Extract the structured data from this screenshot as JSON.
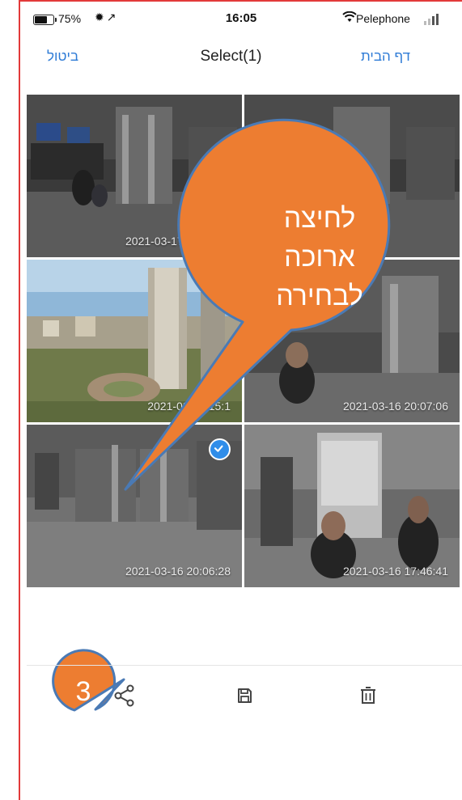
{
  "status_bar": {
    "battery": "75%",
    "battery_level": 0.75,
    "icons": "✹↗",
    "time": "16:05",
    "carrier": "Pelephone"
  },
  "nav": {
    "cancel_label": "ביטול",
    "title": "Select(1)",
    "home_label": "דף הבית"
  },
  "photos": [
    {
      "timestamp": "2021-03-17 15:40:04",
      "selected": false
    },
    {
      "timestamp": "",
      "selected": false
    },
    {
      "timestamp": "2021-03-17 15:1",
      "selected": false
    },
    {
      "timestamp": "2021-03-16 20:07:06",
      "selected": false
    },
    {
      "timestamp": "2021-03-16 20:06:28",
      "selected": true
    },
    {
      "timestamp": "2021-03-16 17:46:41",
      "selected": false
    }
  ],
  "callouts": {
    "main": [
      "לחיצה",
      "ארוכה",
      "לבחירה"
    ],
    "step_number": "3",
    "color": "#ed7d31",
    "border_color": "#4a7ab5"
  },
  "toolbar": {
    "icons": [
      "share-icon",
      "save-icon",
      "delete-icon"
    ]
  },
  "colors": {
    "accent": "#2e7bd6",
    "selection": "#2f8de9",
    "frame": "#e23a3a"
  }
}
